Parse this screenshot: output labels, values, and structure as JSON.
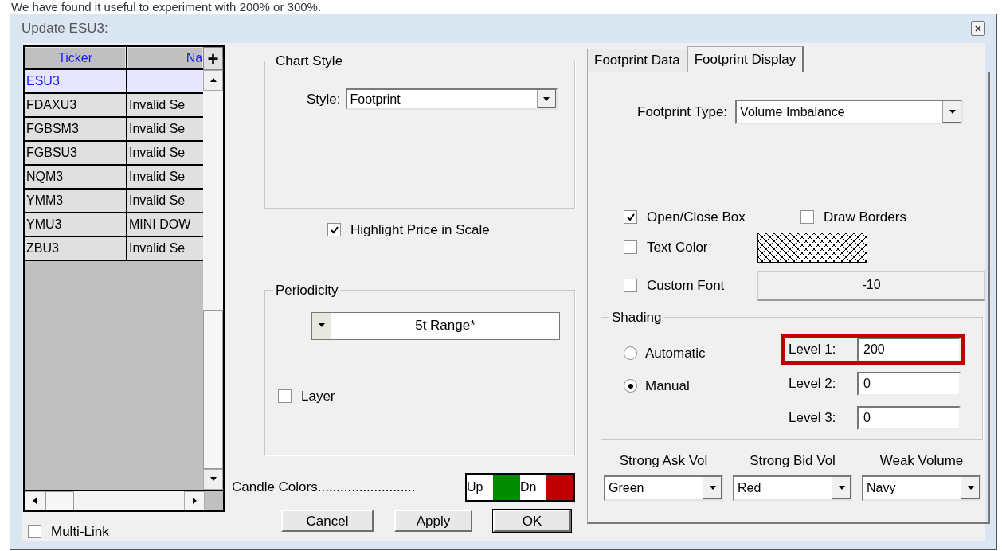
{
  "caption": "We have found it useful to experiment with 200% or 300%.",
  "window": {
    "title": "Update ESU3:"
  },
  "ticker_table": {
    "columns": [
      "Ticker",
      "Na"
    ],
    "rows": [
      {
        "cells": [
          "ESU3",
          ""
        ],
        "selected": true
      },
      {
        "cells": [
          "FDAXU3",
          "Invalid Se"
        ],
        "selected": false
      },
      {
        "cells": [
          "FGBSM3",
          "Invalid Se"
        ],
        "selected": false
      },
      {
        "cells": [
          "FGBSU3",
          "Invalid Se"
        ],
        "selected": false
      },
      {
        "cells": [
          "NQM3",
          "Invalid Se"
        ],
        "selected": false
      },
      {
        "cells": [
          "YMM3",
          "Invalid Se"
        ],
        "selected": false
      },
      {
        "cells": [
          "YMU3",
          "MINI DOW"
        ],
        "selected": false
      },
      {
        "cells": [
          "ZBU3",
          "Invalid Se"
        ],
        "selected": false
      }
    ]
  },
  "add_button": "+",
  "multi_link": {
    "label": "Multi-Link",
    "checked": false
  },
  "chart_style": {
    "title": "Chart Style",
    "style_label": "Style:",
    "style_value": "Footprint"
  },
  "highlight_price": {
    "label": "Highlight Price in Scale",
    "checked": true
  },
  "periodicity": {
    "title": "Periodicity",
    "value": "5t Range*",
    "layer": {
      "label": "Layer",
      "checked": false
    }
  },
  "candle_colors": {
    "label": "Candle Colors..........................",
    "candles": [
      {
        "label": "Up",
        "color": "#008c00"
      },
      {
        "label": "Dn",
        "color": "#c00000"
      }
    ]
  },
  "buttons": [
    {
      "label": "Cancel",
      "default": false
    },
    {
      "label": "Apply",
      "default": false
    },
    {
      "label": "OK",
      "default": true
    }
  ],
  "tabs": [
    {
      "label": "Footprint Data",
      "selected": false
    },
    {
      "label": "Footprint Display",
      "selected": true
    }
  ],
  "footprint_type": {
    "label": "Footprint Type:",
    "value": "Volume Imbalance"
  },
  "options": [
    {
      "label": "Open/Close Box",
      "checked": true
    },
    {
      "label": "Draw Borders",
      "checked": false
    },
    {
      "label": "Text Color",
      "checked": false
    },
    {
      "label": "Custom Font",
      "checked": false
    }
  ],
  "font_value": "-10",
  "shading": {
    "title": "Shading",
    "modes": [
      {
        "label": "Automatic",
        "selected": false
      },
      {
        "label": "Manual",
        "selected": true
      }
    ],
    "levels": [
      {
        "label": "Level 1:",
        "value": "200",
        "highlighted": true
      },
      {
        "label": "Level 2:",
        "value": "0",
        "highlighted": false
      },
      {
        "label": "Level 3:",
        "value": "0",
        "highlighted": false
      }
    ]
  },
  "volume_colors": [
    {
      "label": "Strong Ask Vol",
      "value": "Green"
    },
    {
      "label": "Strong Bid Vol",
      "value": "Red"
    },
    {
      "label": "Weak Volume",
      "value": "Navy"
    }
  ]
}
